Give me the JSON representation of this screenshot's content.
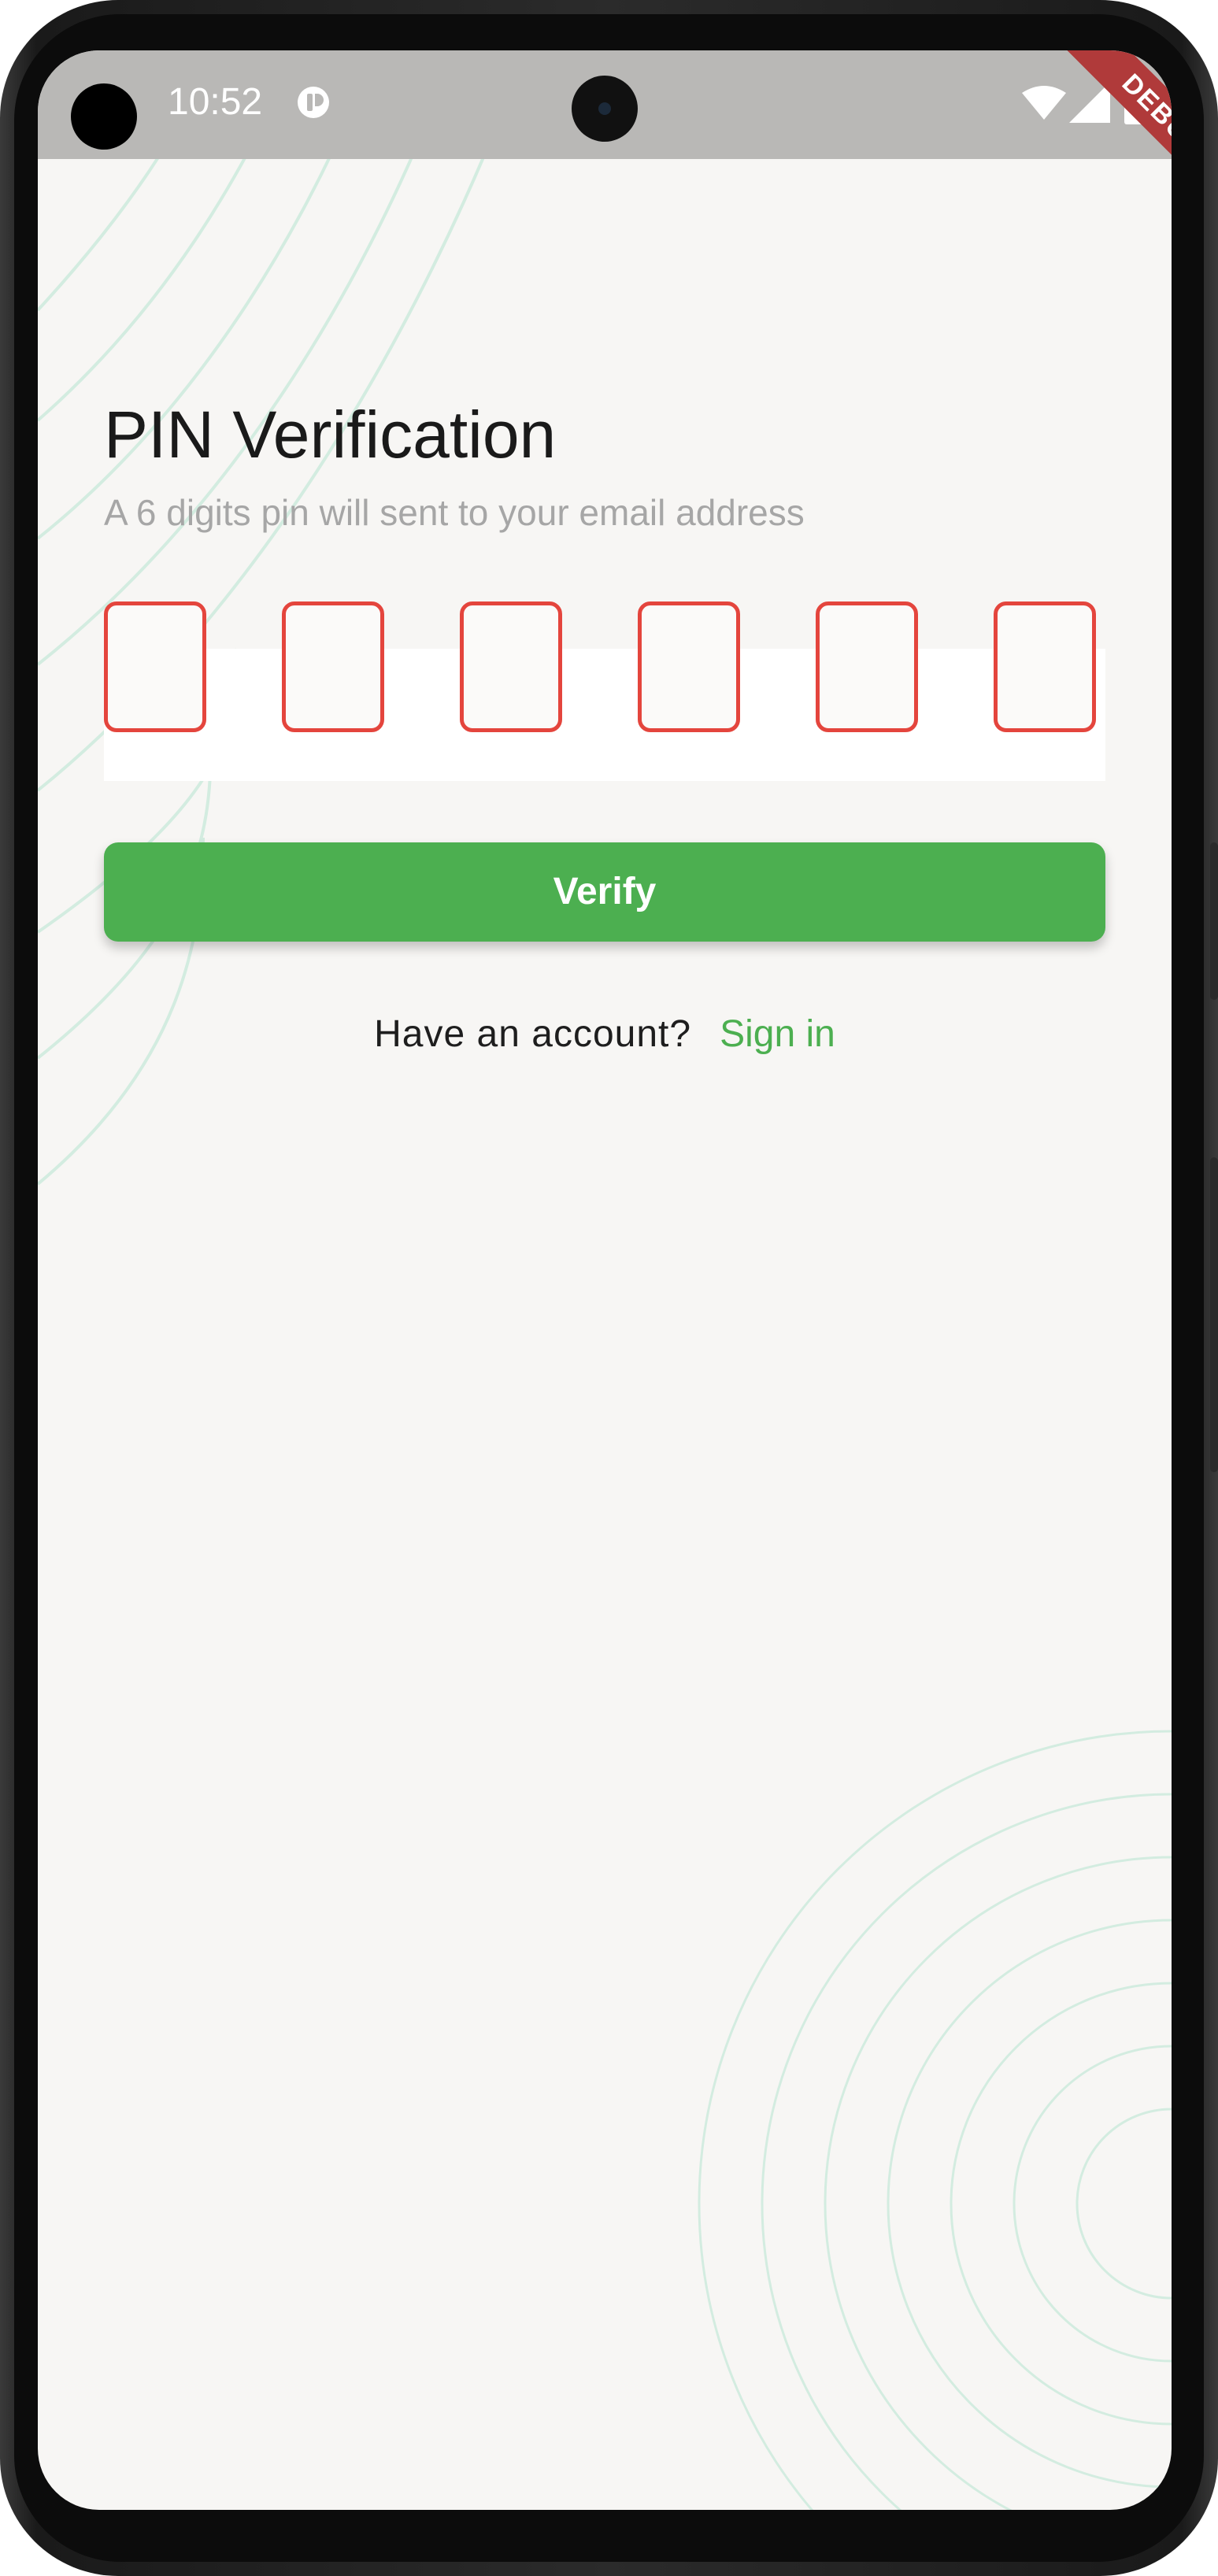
{
  "status_bar": {
    "time": "10:52",
    "icons": [
      "notification-app-icon",
      "wifi-icon",
      "signal-icon",
      "battery-icon"
    ]
  },
  "debug_banner": "DEBUG",
  "page": {
    "title": "PIN Verification",
    "subtitle": "A 6 digits pin will sent to your email address"
  },
  "pin": {
    "length": 6,
    "digits": [
      "",
      "",
      "",
      "",
      "",
      ""
    ],
    "border_color": "#e4453d"
  },
  "verify_button": {
    "label": "Verify",
    "color": "#4caf50"
  },
  "footer": {
    "prompt": "Have an account?",
    "link_label": "Sign in",
    "link_color": "#4caf50"
  },
  "colors": {
    "background": "#f7f6f4",
    "accent": "#4caf50",
    "decoration": "#d3ece0"
  }
}
